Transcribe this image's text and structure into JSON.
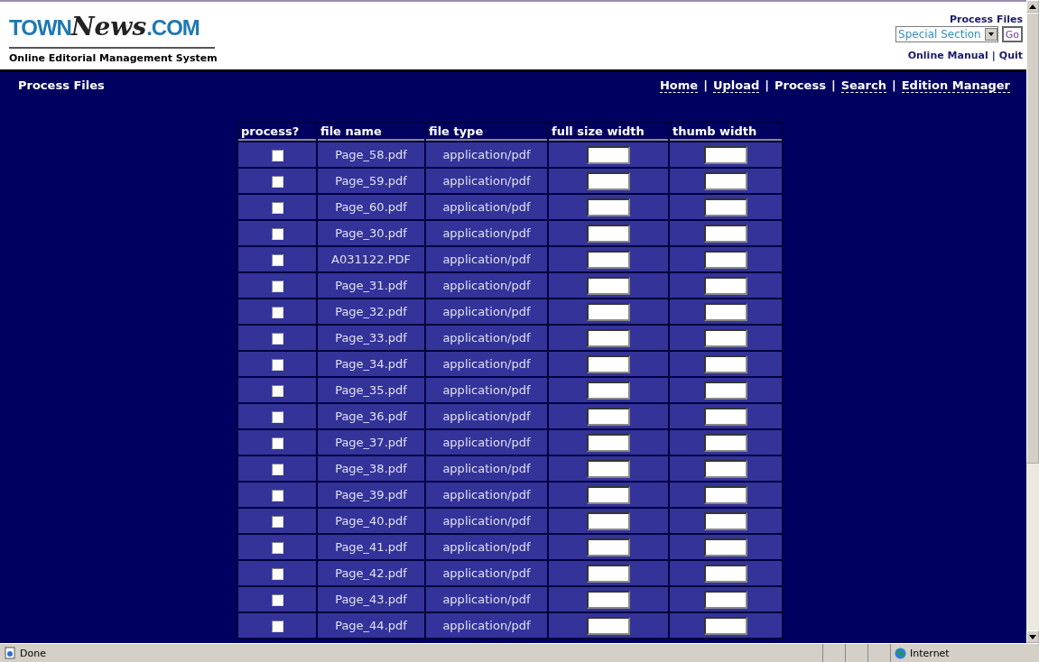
{
  "logo": {
    "left": "TOWN",
    "middle": "News",
    "right": ".COM"
  },
  "subtitle": "Online Editorial Management System",
  "top_right": {
    "title": "Process Files",
    "select": "Special Section",
    "go": "Go",
    "links": [
      "Online Manual",
      "Quit"
    ],
    "separator": "|"
  },
  "nav": {
    "page_title": "Process Files",
    "separator": "|",
    "links": [
      {
        "label": "Home",
        "selected": false
      },
      {
        "label": "Upload",
        "selected": false
      },
      {
        "label": "Process",
        "selected": true
      },
      {
        "label": "Search",
        "selected": false
      },
      {
        "label": "Edition Manager",
        "selected": false
      }
    ]
  },
  "table": {
    "columns": [
      "process?",
      "file name",
      "file type",
      "full size width",
      "thumb width"
    ],
    "rows": [
      {
        "checked": false,
        "file": "Page_58.pdf",
        "type": "application/pdf"
      },
      {
        "checked": false,
        "file": "Page_59.pdf",
        "type": "application/pdf"
      },
      {
        "checked": false,
        "file": "Page_60.pdf",
        "type": "application/pdf"
      },
      {
        "checked": false,
        "file": "Page_30.pdf",
        "type": "application/pdf"
      },
      {
        "checked": false,
        "file": "A031122.PDF",
        "type": "application/pdf"
      },
      {
        "checked": false,
        "file": "Page_31.pdf",
        "type": "application/pdf"
      },
      {
        "checked": false,
        "file": "Page_32.pdf",
        "type": "application/pdf"
      },
      {
        "checked": false,
        "file": "Page_33.pdf",
        "type": "application/pdf"
      },
      {
        "checked": false,
        "file": "Page_34.pdf",
        "type": "application/pdf"
      },
      {
        "checked": false,
        "file": "Page_35.pdf",
        "type": "application/pdf"
      },
      {
        "checked": false,
        "file": "Page_36.pdf",
        "type": "application/pdf"
      },
      {
        "checked": false,
        "file": "Page_37.pdf",
        "type": "application/pdf"
      },
      {
        "checked": false,
        "file": "Page_38.pdf",
        "type": "application/pdf"
      },
      {
        "checked": false,
        "file": "Page_39.pdf",
        "type": "application/pdf"
      },
      {
        "checked": false,
        "file": "Page_40.pdf",
        "type": "application/pdf"
      },
      {
        "checked": false,
        "file": "Page_41.pdf",
        "type": "application/pdf"
      },
      {
        "checked": false,
        "file": "Page_42.pdf",
        "type": "application/pdf"
      },
      {
        "checked": false,
        "file": "Page_43.pdf",
        "type": "application/pdf"
      },
      {
        "checked": false,
        "file": "Page_44.pdf",
        "type": "application/pdf"
      }
    ]
  },
  "status_bar": {
    "text": "Done",
    "zone": "Internet"
  }
}
